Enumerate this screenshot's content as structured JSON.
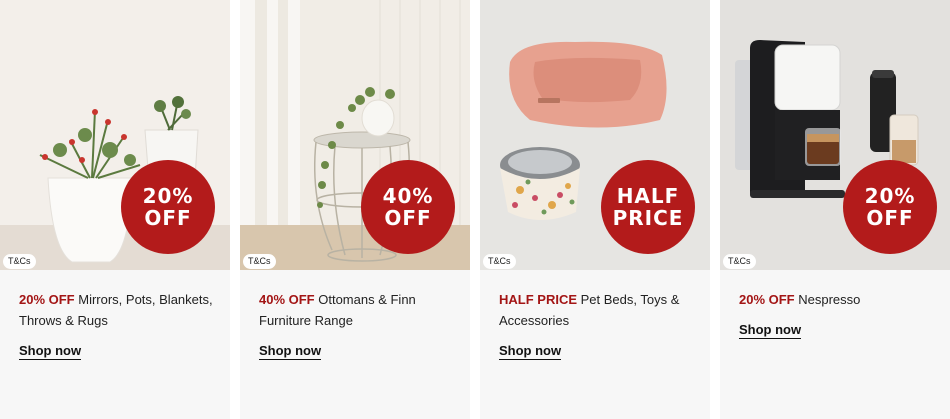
{
  "cards": [
    {
      "badge_line1": "20%",
      "badge_line2": "OFF",
      "promo": "20% OFF",
      "description": " Mirrors, Pots, Blankets, Throws & Rugs",
      "tcs": "T&Cs",
      "shop": "Shop now"
    },
    {
      "badge_line1": "40%",
      "badge_line2": "OFF",
      "promo": "40% OFF",
      "description": " Ottomans & Finn Furniture Range",
      "tcs": "T&Cs",
      "shop": "Shop now"
    },
    {
      "badge_line1": "HALF",
      "badge_line2": "PRICE",
      "promo": "HALF PRICE",
      "description": " Pet Beds, Toys & Accessories",
      "tcs": "T&Cs",
      "shop": "Shop now"
    },
    {
      "badge_line1": "20%",
      "badge_line2": "OFF",
      "promo": "20% OFF",
      "description": " Nespresso",
      "tcs": "T&Cs",
      "shop": "Shop now"
    }
  ],
  "colors": {
    "badge": "#b31b1b",
    "promo_text": "#a31515"
  }
}
